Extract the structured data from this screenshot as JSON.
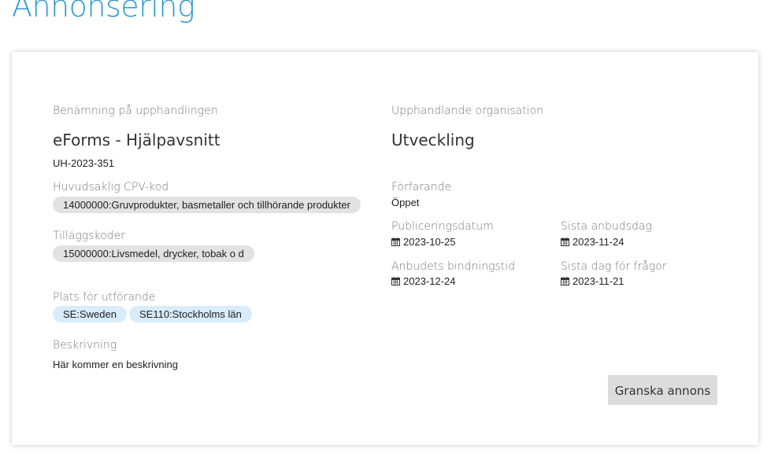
{
  "page": {
    "title": "Annonsering"
  },
  "left": {
    "name_label": "Benämning på upphandlingen",
    "name_value": "eForms - Hjälpavsnitt",
    "reference": "UH-2023-351",
    "cpv_label": "Huvudsaklig CPV-kod",
    "cpv_chip": "14000000:Gruvprodukter, basmetaller och tillhörande produkter",
    "extra_label": "Tilläggskoder",
    "extra_chip": "15000000:Livsmedel, drycker, tobak o d",
    "place_label": "Plats för utförande",
    "place_chips": [
      "SE:Sweden",
      "SE110:Stockholms län"
    ],
    "desc_label": "Beskrivning",
    "desc_value": "Här kommer en beskrivning"
  },
  "right": {
    "org_label": "Upphandlande organisation",
    "org_value": "Utveckling",
    "procedure_label": "Förfarande",
    "procedure_value": "Öppet",
    "pub_label": "Publiceringsdatum",
    "pub_value": "2023-10-25",
    "deadline_label": "Sista anbudsdag",
    "deadline_value": "2023-11-24",
    "binding_label": "Anbudets bindningstid",
    "binding_value": "2023-12-24",
    "questions_label": "Sista dag för frågor",
    "questions_value": "2023-11-21"
  },
  "actions": {
    "review_button": "Granska annons"
  },
  "icons": {
    "date": "calendar-icon"
  },
  "colors": {
    "title": "#2e9ad3",
    "chip_grey": "#e2e2e2",
    "chip_blue": "#d8ecfb",
    "button": "#dcdcdc"
  }
}
